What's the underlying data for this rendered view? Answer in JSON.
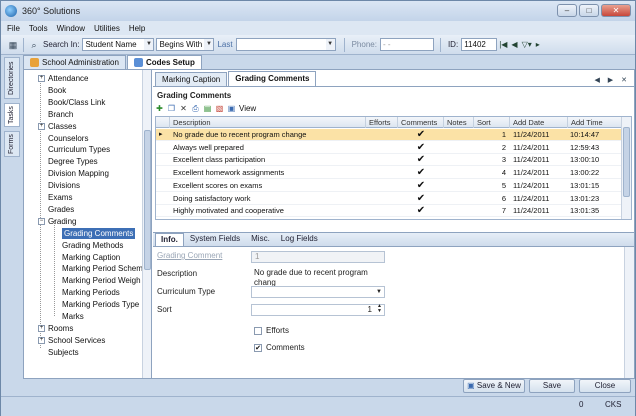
{
  "window": {
    "title": "360° Solutions"
  },
  "menu": [
    "File",
    "Tools",
    "Window",
    "Utilities",
    "Help"
  ],
  "toolbar": {
    "search_in_label": "Search In:",
    "search_in_value": "Student Name",
    "match_value": "Begins With",
    "last_label": "Last",
    "phone_label": "Phone:",
    "phone_value": "- -",
    "id_label": "ID:",
    "id_value": "11402"
  },
  "side_tabs": [
    "Directories",
    "Tasks",
    "Forms"
  ],
  "main_tabs": [
    {
      "label": "School Administration"
    },
    {
      "label": "Codes Setup"
    }
  ],
  "tree": [
    {
      "label": "Attendance",
      "expand": "+"
    },
    {
      "label": "Book",
      "expand": ""
    },
    {
      "label": "Book/Class Link",
      "expand": ""
    },
    {
      "label": "Branch",
      "expand": ""
    },
    {
      "label": "Classes",
      "expand": "+"
    },
    {
      "label": "Counselors",
      "expand": ""
    },
    {
      "label": "Curriculum Types",
      "expand": ""
    },
    {
      "label": "Degree Types",
      "expand": ""
    },
    {
      "label": "Division Mapping",
      "expand": ""
    },
    {
      "label": "Divisions",
      "expand": ""
    },
    {
      "label": "Exams",
      "expand": ""
    },
    {
      "label": "Grades",
      "expand": ""
    },
    {
      "label": "Grading",
      "expand": "−"
    },
    {
      "label": "Grading Comments",
      "expand": "",
      "child": true,
      "selected": true
    },
    {
      "label": "Grading Methods",
      "expand": "",
      "child": true
    },
    {
      "label": "Marking Caption",
      "expand": "",
      "child": true
    },
    {
      "label": "Marking Period Schem",
      "expand": "",
      "child": true
    },
    {
      "label": "Marking Period Weigh",
      "expand": "",
      "child": true
    },
    {
      "label": "Marking Periods",
      "expand": "",
      "child": true
    },
    {
      "label": "Marking Periods Type",
      "expand": "",
      "child": true
    },
    {
      "label": "Marks",
      "expand": "",
      "child": true
    },
    {
      "label": "Rooms",
      "expand": "+"
    },
    {
      "label": "School Services",
      "expand": "+"
    },
    {
      "label": "Subjects",
      "expand": ""
    }
  ],
  "sub_tabs": [
    {
      "label": "Marking Caption"
    },
    {
      "label": "Grading Comments"
    }
  ],
  "grading_comments_title": "Grading Comments",
  "grid_toolbar": {
    "view_label": "View"
  },
  "grid": {
    "columns": [
      "Description",
      "Efforts",
      "Comments",
      "Notes",
      "Sort",
      "Add Date",
      "Add Time"
    ],
    "rows": [
      {
        "description": "No grade due to recent program change",
        "comments": "✔",
        "sort": "1",
        "date": "11/24/2011",
        "time": "10:14:47"
      },
      {
        "description": "Always well prepared",
        "comments": "✔",
        "sort": "2",
        "date": "11/24/2011",
        "time": "12:59:43"
      },
      {
        "description": "Excellent class participation",
        "comments": "✔",
        "sort": "3",
        "date": "11/24/2011",
        "time": "13:00:10"
      },
      {
        "description": "Excellent homework assignments",
        "comments": "✔",
        "sort": "4",
        "date": "11/24/2011",
        "time": "13:00:22"
      },
      {
        "description": "Excellent scores on exams",
        "comments": "✔",
        "sort": "5",
        "date": "11/24/2011",
        "time": "13:01:15"
      },
      {
        "description": "Doing satisfactory work",
        "comments": "✔",
        "sort": "6",
        "date": "11/24/2011",
        "time": "13:01:23"
      },
      {
        "description": "Highly motivated and cooperative",
        "comments": "✔",
        "sort": "7",
        "date": "11/24/2011",
        "time": "13:01:35"
      }
    ]
  },
  "detail_tabs": [
    "Info.",
    "System Fields",
    "Misc.",
    "Log Fields"
  ],
  "form": {
    "grading_comment_label": "Grading Comment",
    "grading_comment_value": "1",
    "description_label": "Description",
    "description_value": "No grade due to recent program chang",
    "curriculum_type_label": "Curriculum Type",
    "curriculum_type_value": "",
    "sort_label": "Sort",
    "sort_value": "1",
    "efforts_label": "Efforts",
    "efforts_checked": false,
    "comments_label": "Comments",
    "comments_checked": true
  },
  "buttons": {
    "save_new": "Save & New",
    "save": "Save",
    "close": "Close"
  },
  "status": {
    "num": "0",
    "user": "CKS"
  }
}
